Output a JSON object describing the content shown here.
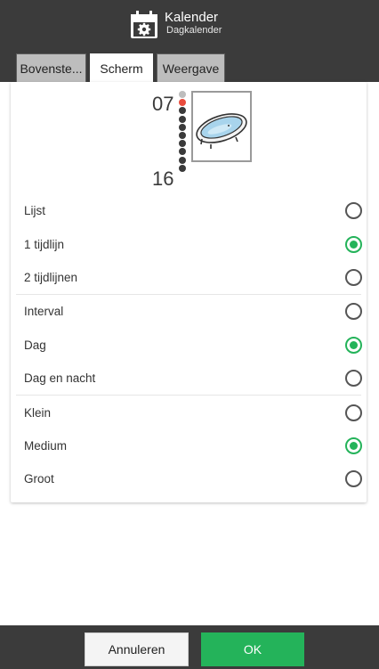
{
  "header": {
    "title": "Kalender",
    "subtitle": "Dagkalender",
    "icon": "calendar-gear-icon"
  },
  "tabs": [
    {
      "label": "Bovenste...",
      "active": false
    },
    {
      "label": "Scherm",
      "active": true
    },
    {
      "label": "Weergave",
      "active": false
    }
  ],
  "preview": {
    "start_hour": "07",
    "end_hour": "16",
    "image": "bathtub-icon",
    "current_marker_color": "#e94c3d"
  },
  "options": [
    [
      {
        "label": "Lijst",
        "selected": false
      },
      {
        "label": "1 tijdlijn",
        "selected": true
      },
      {
        "label": "2 tijdlijnen",
        "selected": false
      }
    ],
    [
      {
        "label": "Interval",
        "selected": false
      },
      {
        "label": "Dag",
        "selected": true
      },
      {
        "label": "Dag en nacht",
        "selected": false
      }
    ],
    [
      {
        "label": "Klein",
        "selected": false
      },
      {
        "label": "Medium",
        "selected": true
      },
      {
        "label": "Groot",
        "selected": false
      }
    ]
  ],
  "footer": {
    "cancel_label": "Annuleren",
    "ok_label": "OK"
  },
  "colors": {
    "accent": "#24b35a",
    "header_bg": "#3b3b3b"
  }
}
